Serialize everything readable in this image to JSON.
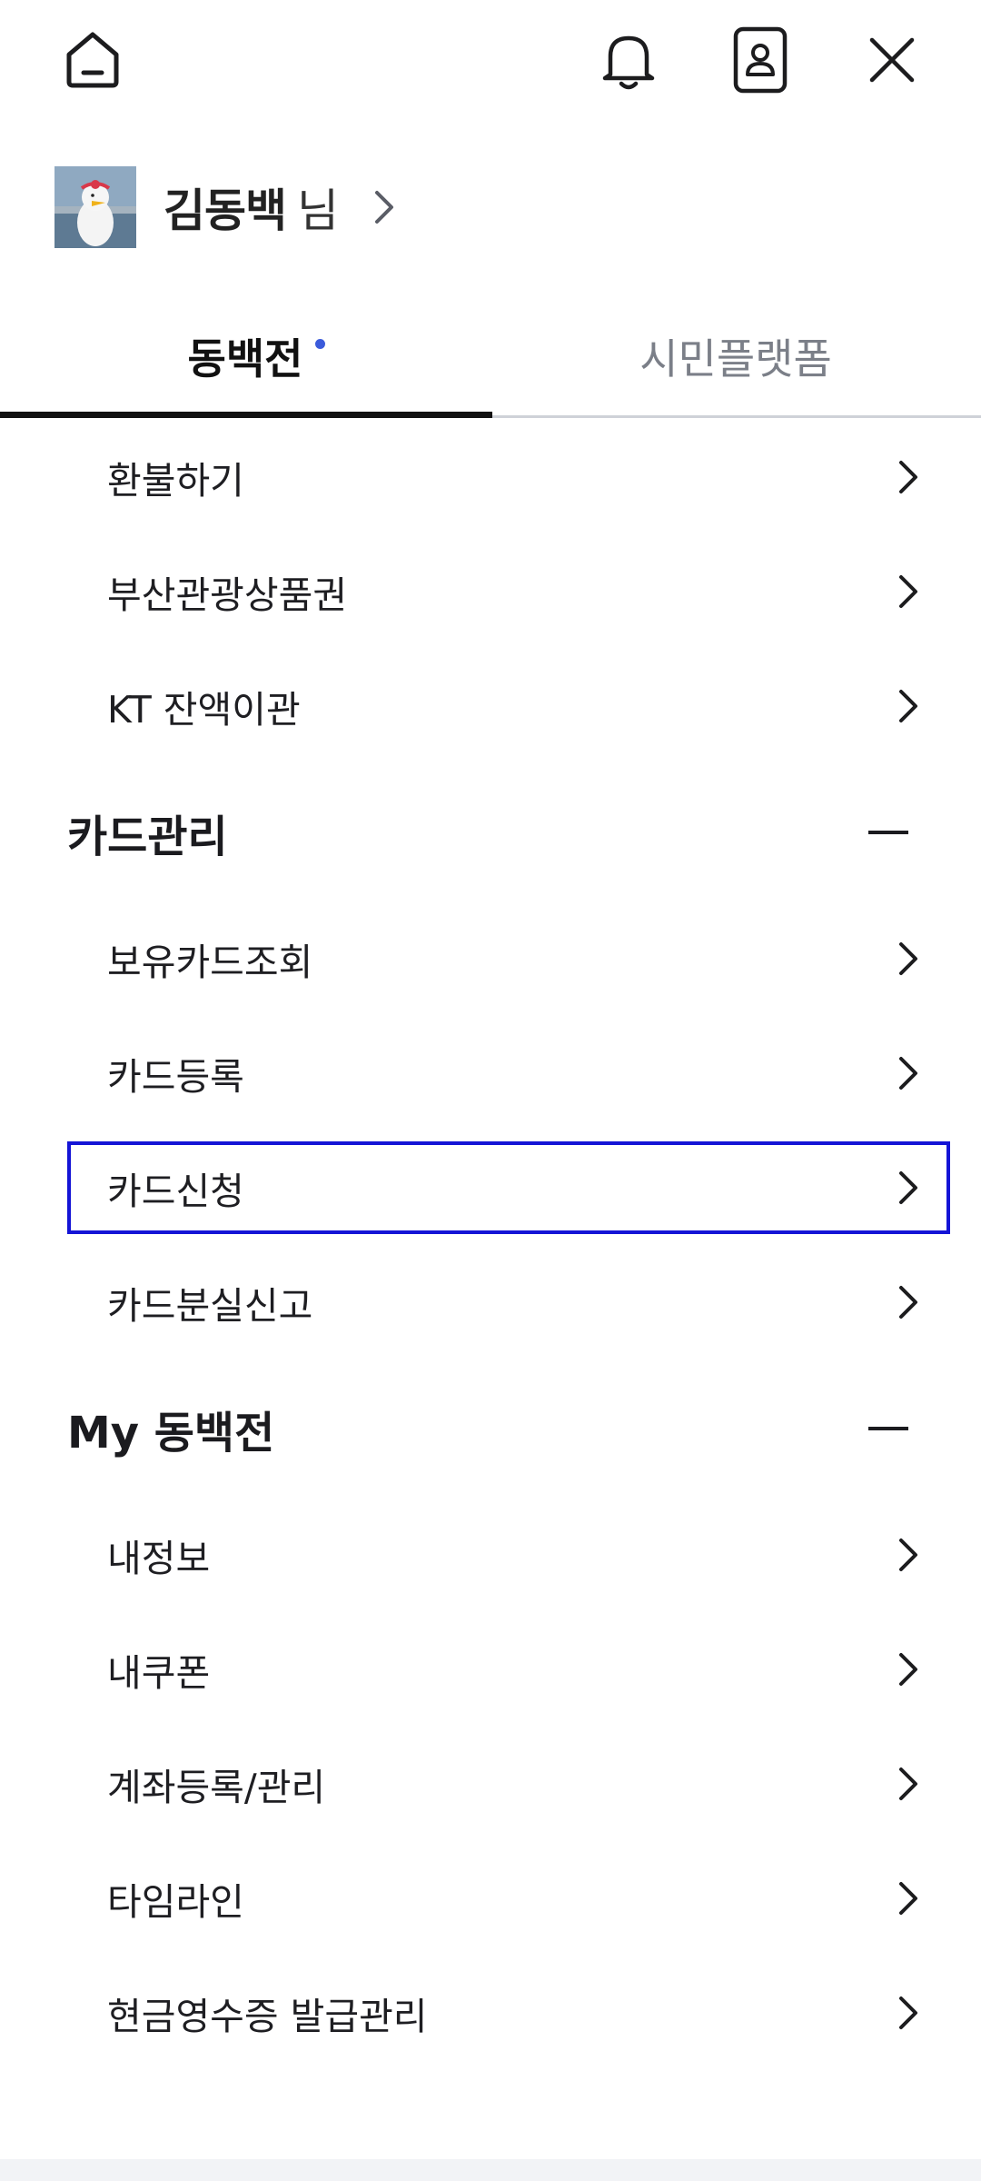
{
  "header": {
    "icons": [
      "home-icon",
      "bell-icon",
      "id-card-icon",
      "close-icon"
    ]
  },
  "profile": {
    "name": "김동백",
    "suffix": "님"
  },
  "tabs": [
    {
      "label": "동백전",
      "active": true,
      "has_dot": true
    },
    {
      "label": "시민플랫폼",
      "active": false
    }
  ],
  "menu": {
    "top_items": [
      "환불하기",
      "부산관광상품권",
      "KT 잔액이관"
    ],
    "sections": [
      {
        "title": "카드관리",
        "items": [
          "보유카드조회",
          "카드등록",
          "카드신청",
          "카드분실신고"
        ]
      },
      {
        "title": "My 동백전",
        "items": [
          "내정보",
          "내쿠폰",
          "계좌등록/관리",
          "타임라인",
          "현금영수증 발급관리"
        ]
      }
    ]
  },
  "colors": {
    "selection_border": "#1414d6",
    "tab_dot": "#3b5bdb",
    "inactive_tab": "#7b7f88"
  }
}
